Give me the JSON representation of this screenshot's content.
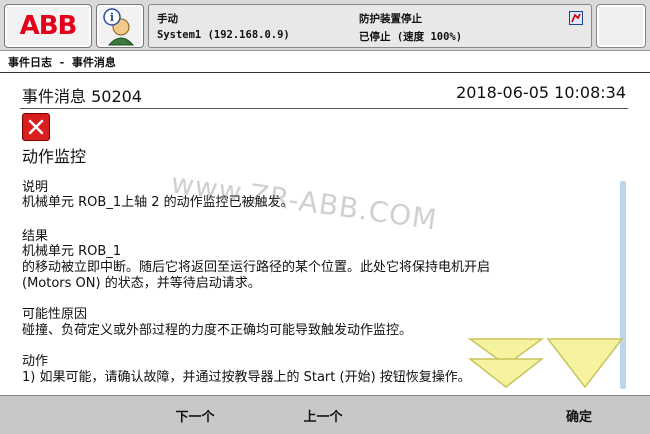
{
  "status": {
    "mode": "手动",
    "system": "System1 (192.168.0.9)",
    "guard": "防护装置停止",
    "state": "已停止 (速度 100%)"
  },
  "breadcrumb": "事件日志 - 事件消息",
  "event": {
    "title": "事件消息 50204",
    "datetime": "2018-06-05 10:08:34",
    "subject": "动作监控",
    "sections": [
      {
        "heading": "说明",
        "lines": [
          "机械单元 ROB_1上轴 2 的动作监控已被触发。"
        ]
      },
      {
        "heading": "结果",
        "lines": [
          "机械单元 ROB_1",
          "的移动被立即中断。随后它将返回至运行路径的某个位置。此处它将保持电机开启",
          "(Motors ON) 的状态，并等待启动请求。"
        ]
      },
      {
        "heading": "可能性原因",
        "lines": [
          "碰撞、负荷定义或外部过程的力度不正确均可能导致触发动作监控。"
        ]
      },
      {
        "heading": "动作",
        "lines": [
          "1) 如果可能，请确认故障，并通过按教导器上的 Start (开始) 按钮恢复操作。"
        ]
      }
    ]
  },
  "watermark": "www.ZR-ABB.COM",
  "logo_text": "ABB",
  "buttons": {
    "next": "下一个",
    "prev": "上一个",
    "ok": "确定"
  },
  "colors": {
    "abb_red": "#e2001a",
    "error_red": "#d81e1e",
    "scroll": "#bcd7ec"
  }
}
